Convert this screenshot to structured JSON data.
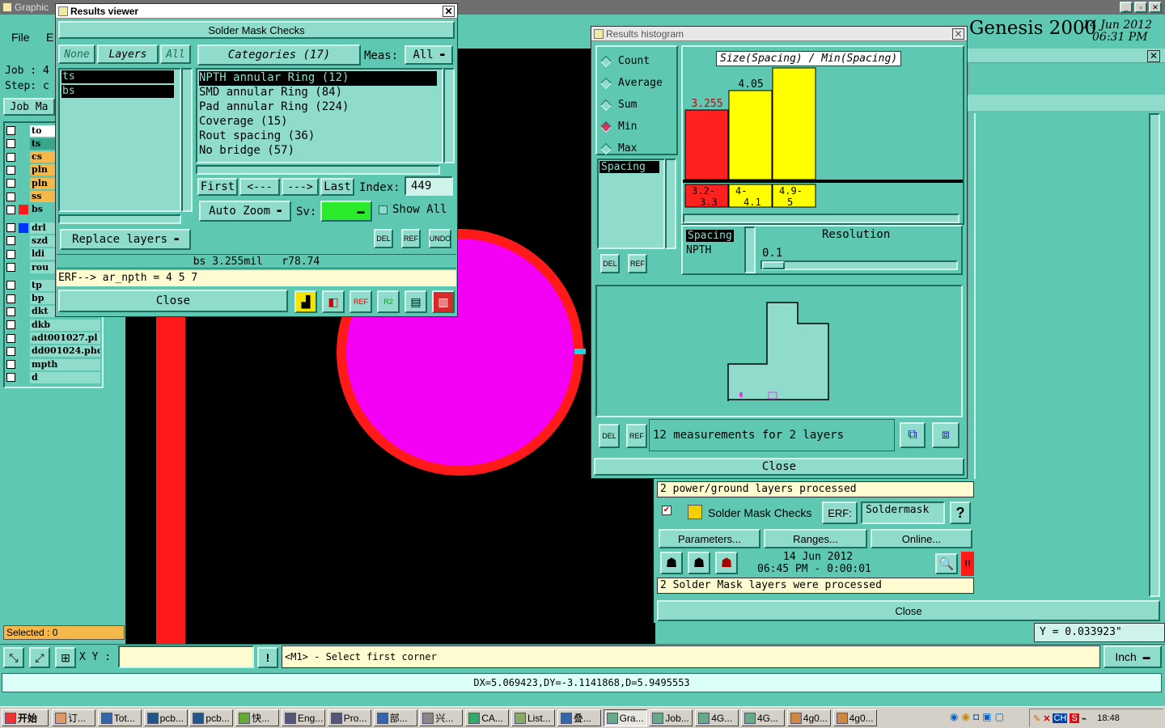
{
  "app": {
    "window_title": "Graphic",
    "brand": "Genesis 2000",
    "date": "14 Jun 2012",
    "time": "06:31 PM",
    "menu_file": "File",
    "menu_e": "E",
    "job_label": "Job :",
    "job_value": "4",
    "step_label": "Step:",
    "step_value": "c",
    "job_matrix_btn": "Job Ma",
    "selected_label": "Selected : 0",
    "xy_label": "X Y :",
    "prompt_text": "<M1> - Select first corner",
    "units": "Inch",
    "y_readout": "Y = 0.033923\"",
    "measure_readout": "DX=5.069423,DY=-3.1141868,D=5.9495553"
  },
  "layers_panel": [
    {
      "name": "to",
      "color": "#ffffff"
    },
    {
      "name": "ts",
      "color": "#3aa58e"
    },
    {
      "name": "cs",
      "color": "#f5b84a"
    },
    {
      "name": "pln",
      "color": "#f5b84a"
    },
    {
      "name": "pln",
      "color": "#f5b84a"
    },
    {
      "name": "ss",
      "color": "#f5b84a"
    },
    {
      "name": "bs",
      "color": "#5fc8b3"
    },
    {
      "name": "drl",
      "color": "#8fdccc"
    },
    {
      "name": "szd",
      "color": "#8fdccc"
    },
    {
      "name": "ldi",
      "color": "#8fdccc"
    },
    {
      "name": "rou",
      "color": "#8fdccc"
    },
    {
      "name": "tp",
      "color": "#8fdccc"
    },
    {
      "name": "bp",
      "color": "#8fdccc"
    },
    {
      "name": "dkt",
      "color": "#8fdccc"
    },
    {
      "name": "dkb",
      "color": "#8fdccc"
    },
    {
      "name": "adt001027.pl",
      "color": "#8fdccc"
    },
    {
      "name": "dd001024.pho",
      "color": "#8fdccc"
    },
    {
      "name": "mpth",
      "color": "#8fdccc"
    },
    {
      "name": "d",
      "color": "#8fdccc"
    }
  ],
  "results_viewer": {
    "title": "Results viewer",
    "heading": "Solder Mask Checks",
    "none_btn": "None",
    "layers_btn": "Layers",
    "all_btn": "All",
    "layers": [
      "ts",
      "bs"
    ],
    "categories_btn": "Categories (17)",
    "meas_label": "Meas:",
    "meas_value": "All",
    "categories": [
      "NPTH annular Ring (12)",
      "SMD annular Ring (84)",
      "Pad annular Ring (224)",
      "Coverage (15)",
      "Rout spacing (36)",
      "No bridge (57)"
    ],
    "first_btn": "First",
    "prev_btn": "<---",
    "next_btn": "--->",
    "last_btn": "Last",
    "index_label": "Index:",
    "index_value": "449",
    "auto_zoom": "Auto Zoom",
    "sv_label": "Sv:",
    "show_all": "Show All",
    "replace_layers": "Replace layers",
    "del_label": "DEL",
    "ref_label": "REF",
    "undo_label": "UNDO",
    "status": "bs 3.255mil   r78.74",
    "erf_line": "ERF--> ar_npth = 4 5 7",
    "close_btn": "Close",
    "ref_icon_label": "REF",
    "r2_icon_label": "R2"
  },
  "histogram": {
    "title": "Results histogram",
    "modes": [
      "Count",
      "Average",
      "Sum",
      "Min",
      "Max"
    ],
    "selected_mode": "Min",
    "list_item": "Spacing",
    "chart_title": "Size(Spacing) / Min(Spacing)",
    "bars": [
      {
        "value": "3.255",
        "range": "3.2-3.3",
        "color": "#ff2020",
        "label_color": "#d00000",
        "fraction": 0.43
      },
      {
        "value": "4.05",
        "range": "4-4.1",
        "color": "#ffff00",
        "label_color": "#000000",
        "fraction": 0.55
      },
      {
        "value": "4.955",
        "range": "4.9-5",
        "color": "#ffff00",
        "label_color": "#000000",
        "fraction": 0.69
      }
    ],
    "spacing_label": "Spacing",
    "npth_label": "NPTH",
    "resolution_label": "Resolution",
    "resolution_value": "0.1",
    "summary": "12 measurements for 2 layers",
    "close_btn": "Close"
  },
  "checks_panel": {
    "line1": "2 power/ground layers processed",
    "check_name": "Solder Mask Checks",
    "erf_label": "ERF:",
    "erf_value": "Soldermask",
    "help_btn": "?",
    "parameters_btn": "Parameters...",
    "ranges_btn": "Ranges...",
    "online_btn": "Online...",
    "date": "14 Jun 2012",
    "time_line": "06:45 PM - 0:00:01",
    "line2": "2 Solder Mask layers were processed",
    "close_btn": "Close",
    "alert": "!!"
  },
  "taskbar": {
    "start": "开始",
    "clock": "18:48",
    "items": [
      "订...",
      "Tot...",
      "pcb...",
      "pcb...",
      "快...",
      "Eng...",
      "Pro...",
      "部...",
      "兴...",
      "CA...",
      "List...",
      "叠...",
      "Gra...",
      "Job...",
      "4G...",
      "4G...",
      "4g0...",
      "4g0..."
    ],
    "lang": "CH",
    "s_label": "S"
  }
}
